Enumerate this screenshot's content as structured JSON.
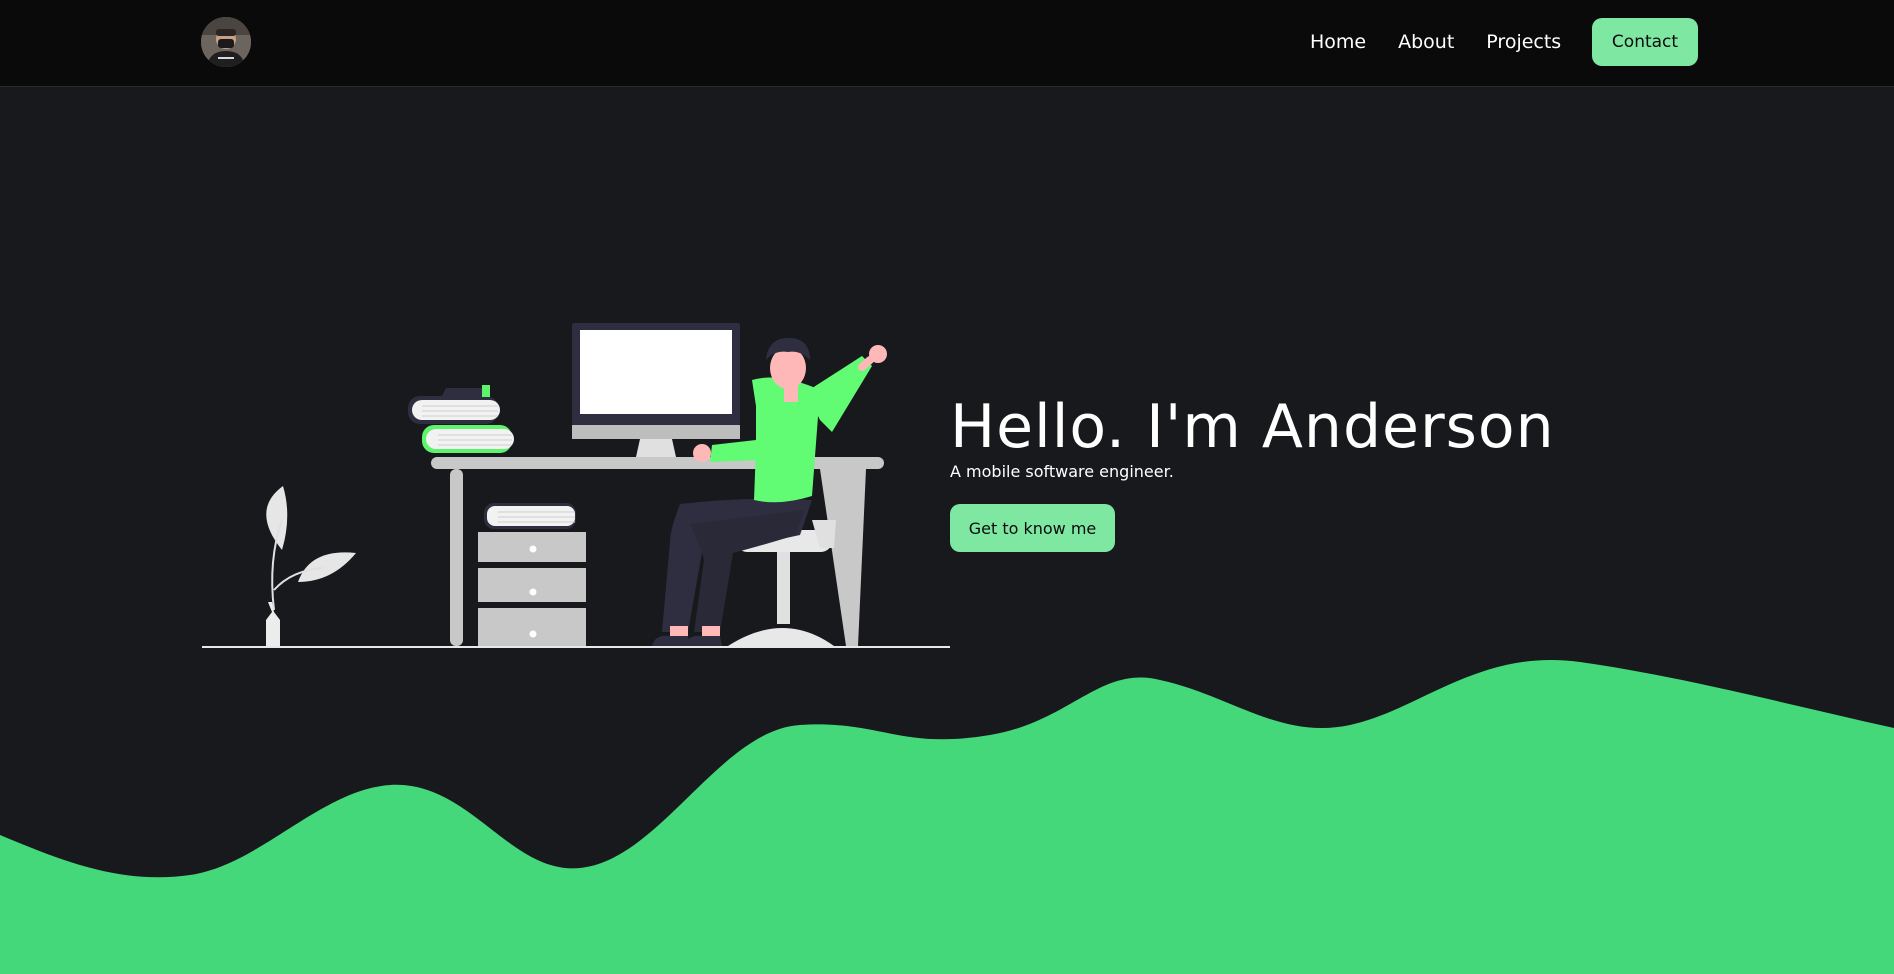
{
  "nav": {
    "avatar_icon": "profile-avatar",
    "links": [
      {
        "label": "Home"
      },
      {
        "label": "About"
      },
      {
        "label": "Projects"
      }
    ],
    "contact_label": "Contact"
  },
  "hero": {
    "title": "Hello. I'm Anderson",
    "subtitle": "A mobile software engineer.",
    "cta_label": "Get to know me",
    "illustration": "person-working-at-desk-illustration"
  },
  "colors": {
    "background": "#18191c",
    "navbar": "#0a0a0b",
    "accent": "#7ee8a2",
    "wave": "#45d87b",
    "shirt": "#62fc74"
  }
}
